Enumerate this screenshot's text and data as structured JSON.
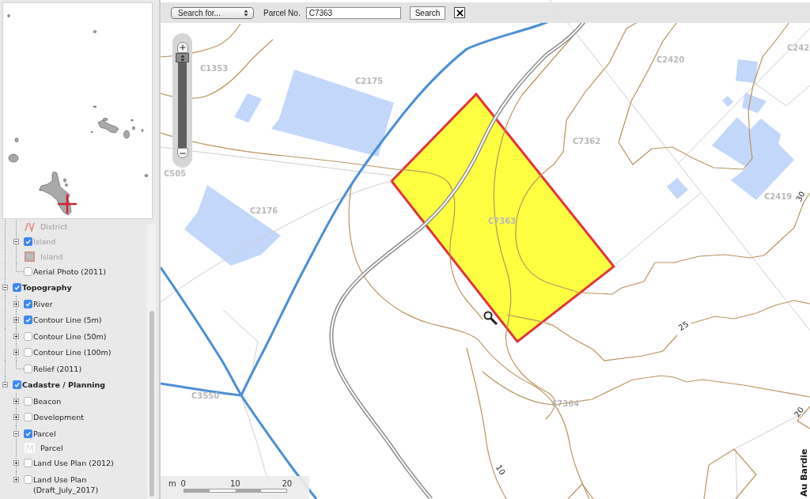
{
  "layers": [
    {
      "kind": "continued",
      "children": [
        {
          "kind": "continued",
          "children": [
            {
              "kind": "line-legend",
              "label": "District",
              "disabled": true
            }
          ]
        },
        {
          "kind": "expandable",
          "label": "Island",
          "checked": true,
          "expanded": true,
          "disabled": true,
          "children": [
            {
              "kind": "fill-legend",
              "label": "Island",
              "disabled": true
            }
          ]
        },
        {
          "kind": "leaf",
          "label": "Aerial Photo (2011)",
          "checked": false,
          "disabled": false
        }
      ]
    },
    {
      "kind": "expandable",
      "label": "Topography",
      "checked": true,
      "expanded": true,
      "disabled": false,
      "children": [
        {
          "kind": "expandable",
          "label": "River",
          "checked": true,
          "expanded": false,
          "disabled": false
        },
        {
          "kind": "expandable",
          "label": "Contour Line (5m)",
          "checked": true,
          "expanded": false,
          "disabled": false
        },
        {
          "kind": "expandable",
          "label": "Contour Line (50m)",
          "checked": false,
          "expanded": false,
          "disabled": false
        },
        {
          "kind": "expandable",
          "label": "Contour Line (100m)",
          "checked": false,
          "expanded": false,
          "disabled": false
        },
        {
          "kind": "leaf",
          "label": "Relief (2011)",
          "checked": false,
          "disabled": false
        }
      ]
    },
    {
      "kind": "expandable",
      "label": "Cadastre / Planning",
      "checked": true,
      "expanded": true,
      "disabled": false,
      "children": [
        {
          "kind": "expandable",
          "label": "Beacon",
          "checked": false,
          "expanded": false,
          "disabled": false
        },
        {
          "kind": "expandable",
          "label": "Development",
          "checked": false,
          "expanded": false,
          "disabled": false
        },
        {
          "kind": "expandable",
          "label": "Parcel",
          "checked": true,
          "expanded": true,
          "disabled": false,
          "children": [
            {
              "kind": "outline-legend",
              "label": "Parcel",
              "disabled": false
            }
          ]
        },
        {
          "kind": "expandable",
          "label": "Land Use Plan (2012)",
          "checked": false,
          "expanded": false,
          "disabled": false
        },
        {
          "kind": "expandable",
          "label": "Land Use Plan (Draft_July_2017)",
          "checked": false,
          "expanded": false,
          "disabled": false
        }
      ]
    }
  ],
  "search_bar": {
    "search_type": "Search for...",
    "field_label": "Parcel No.",
    "value": "C7363",
    "button": "Search"
  },
  "zoom_slider": {
    "level": 1
  },
  "map": {
    "parcel_labels": [
      "C1353",
      "C2175",
      "C505",
      "C2176",
      "C7362",
      "C7363",
      "C2420",
      "C2419",
      "C3550",
      "C7364",
      "C242"
    ],
    "contour_labels": [
      "25",
      "30",
      "20",
      "10"
    ],
    "road_label": "Au Bardie"
  },
  "scale_bar": {
    "unit": "m",
    "ticks": [
      "0",
      "10",
      "20"
    ]
  }
}
